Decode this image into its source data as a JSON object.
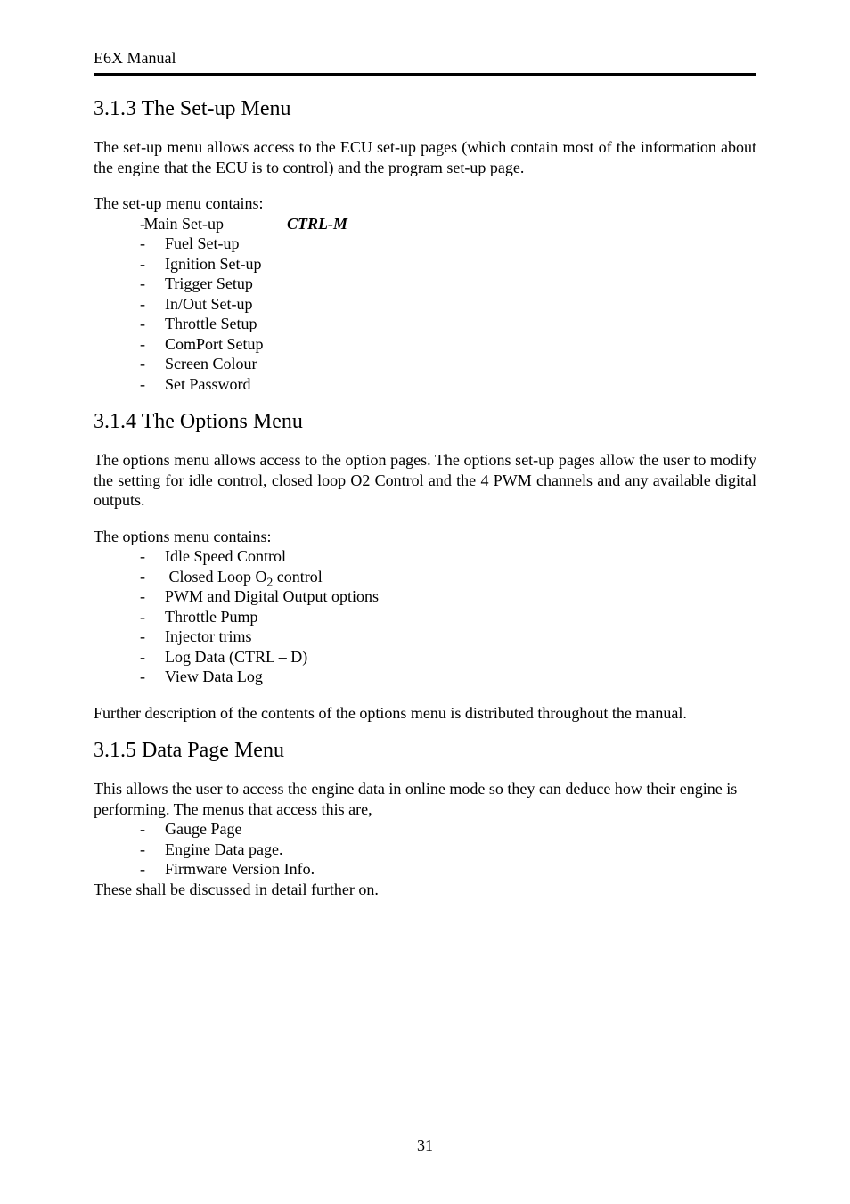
{
  "header": {
    "title": "E6X Manual"
  },
  "section_313": {
    "heading": "3.1.3 The Set-up Menu",
    "para1": "The set-up menu allows access to the ECU set-up pages (which contain most of the information about the engine that the ECU is to control) and the program set-up page.",
    "intro": "The set-up menu contains:",
    "items": [
      {
        "label": "Main Set-up",
        "shortcut": "CTRL-M"
      },
      {
        "label": "Fuel Set-up"
      },
      {
        "label": "Ignition Set-up"
      },
      {
        "label": "Trigger Setup"
      },
      {
        "label": "In/Out Set-up"
      },
      {
        "label": "Throttle Setup"
      },
      {
        "label": "ComPort Setup"
      },
      {
        "label": "Screen Colour"
      },
      {
        "label": "Set Password"
      }
    ]
  },
  "section_314": {
    "heading": "3.1.4 The Options Menu",
    "para1": "The options menu allows access to the option pages.  The options set-up pages allow the user to modify the setting for idle control, closed loop O2 Control and the 4 PWM channels and any available digital outputs.",
    "intro": "The options menu contains:",
    "items": {
      "i0": "Idle Speed Control",
      "i1_pre": "Closed Loop O",
      "i1_sub": "2",
      "i1_post": " control",
      "i2": "PWM and Digital Output options",
      "i3": "Throttle Pump",
      "i4": "Injector trims",
      "i5": "Log Data (CTRL – D)",
      "i6": "View Data Log"
    },
    "para2": "Further description of the contents of the options menu is distributed throughout the manual."
  },
  "section_315": {
    "heading": "3.1.5 Data Page Menu",
    "para1": "This allows the user to access the engine data in online mode so they can deduce how their engine is performing. The menus that access this are,",
    "items": {
      "i0": "Gauge Page",
      "i1": "Engine Data page.",
      "i2": "Firmware Version Info."
    },
    "para2": "These shall be discussed in detail further on."
  },
  "footer": {
    "page_number": "31"
  }
}
